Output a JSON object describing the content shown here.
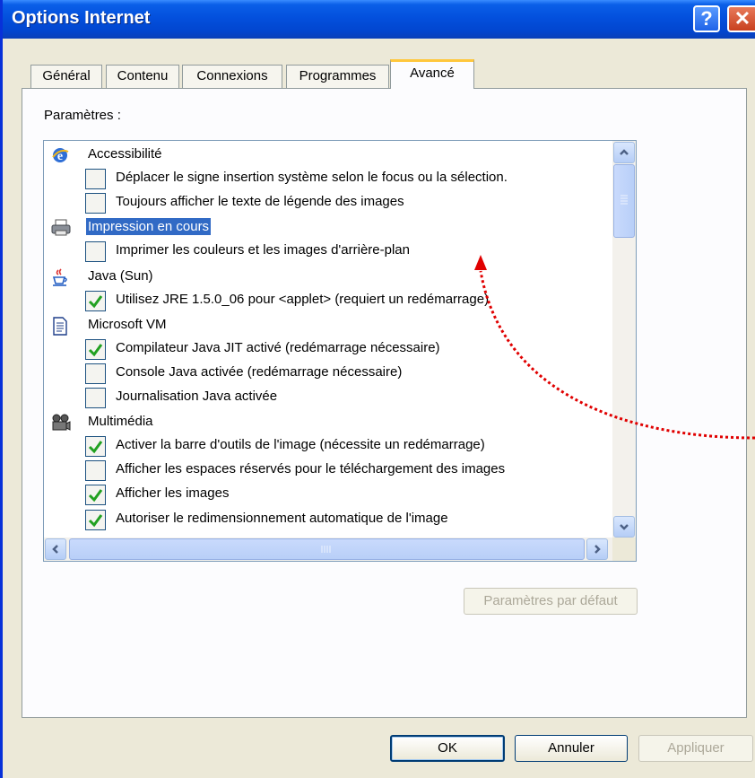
{
  "window": {
    "title": "Options Internet",
    "help_glyph": "?",
    "close_glyph": "✕"
  },
  "tabs": [
    {
      "label": "Général"
    },
    {
      "label": "Contenu"
    },
    {
      "label": "Connexions"
    },
    {
      "label": "Programmes"
    },
    {
      "label": "Avancé",
      "active": true
    }
  ],
  "settings": {
    "label": "Paramètres :",
    "rows": [
      {
        "type": "category",
        "icon": "ie-globe-icon",
        "label": "Accessibilité"
      },
      {
        "type": "option",
        "checked": false,
        "label": "Déplacer le signe insertion système selon le focus ou la sélection."
      },
      {
        "type": "option",
        "checked": false,
        "label": "Toujours afficher le texte de légende des images"
      },
      {
        "type": "category",
        "icon": "printer-icon",
        "label": "Impression en cours",
        "selected": true
      },
      {
        "type": "option",
        "checked": false,
        "label": "Imprimer les couleurs et les images d'arrière-plan"
      },
      {
        "type": "category",
        "icon": "java-cup-icon",
        "label": "Java (Sun)"
      },
      {
        "type": "option",
        "checked": true,
        "label": "Utilisez JRE 1.5.0_06 pour <applet> (requiert un redémarrage)"
      },
      {
        "type": "category",
        "icon": "document-icon",
        "label": "Microsoft VM"
      },
      {
        "type": "option",
        "checked": true,
        "label": "Compilateur Java JIT activé (redémarrage nécessaire)"
      },
      {
        "type": "option",
        "checked": false,
        "label": "Console Java activée (redémarrage nécessaire)"
      },
      {
        "type": "option",
        "checked": false,
        "label": "Journalisation Java activée"
      },
      {
        "type": "category",
        "icon": "multimedia-icon",
        "label": "Multimédia"
      },
      {
        "type": "option",
        "checked": true,
        "label": "Activer la barre d'outils de l'image (nécessite un redémarrage)"
      },
      {
        "type": "option",
        "checked": false,
        "label": "Afficher les espaces réservés pour le téléchargement des images"
      },
      {
        "type": "option",
        "checked": true,
        "label": "Afficher les images"
      },
      {
        "type": "option",
        "checked": true,
        "label": "Autoriser le redimensionnement automatique de l'image"
      }
    ]
  },
  "buttons": {
    "defaults": "Paramètres par défaut",
    "ok": "OK",
    "cancel": "Annuler",
    "apply": "Appliquer"
  },
  "colors": {
    "selection": "#316ac5",
    "annotation": "#e00000",
    "check": "#21a121"
  }
}
